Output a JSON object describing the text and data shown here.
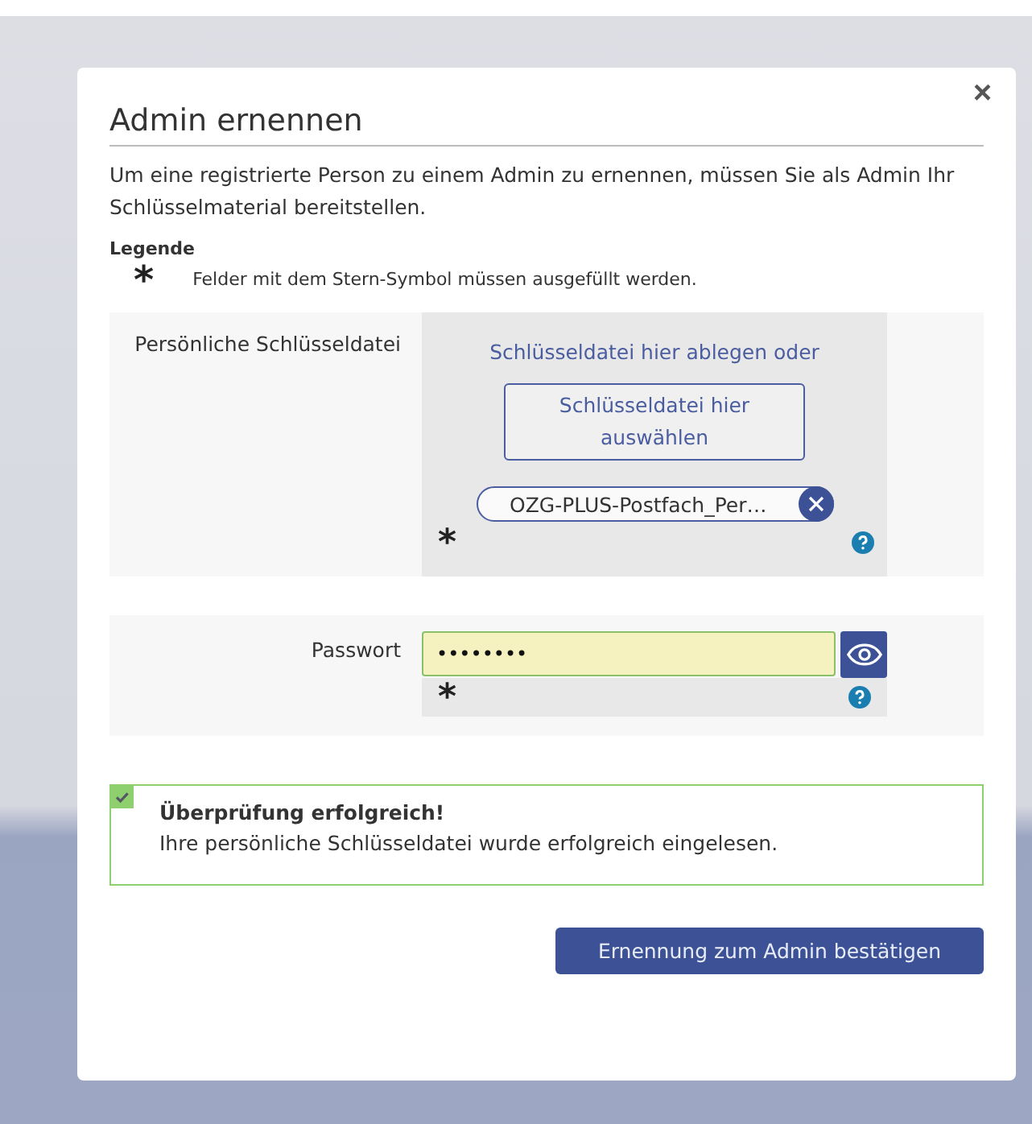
{
  "dialog": {
    "title": "Admin ernennen",
    "close": "×",
    "intro": "Um eine registrierte Person zu einem Admin zu ernennen, müssen Sie als Admin Ihr Schlüsselmaterial bereitstellen.",
    "legend": {
      "heading": "Legende",
      "symbol": "*",
      "text": "Felder mit dem Stern-Symbol müssen ausgefüllt werden."
    },
    "key_file": {
      "label": "Persönliche Schlüsseldatei",
      "drop_text": "Schlüsseldatei hier ablegen oder",
      "select_button": "Schlüsseldatei hier auswählen",
      "file_name": "OZG-PLUS-Postfach_Per…",
      "required_mark": "*"
    },
    "password": {
      "label": "Passwort",
      "value": "••••••••",
      "valid": true,
      "required_mark": "*"
    },
    "alert": {
      "kind": "success",
      "title": "Überprüfung erfolgreich!",
      "message": "Ihre persönliche Schlüsseldatei wurde erfolgreich eingelesen."
    },
    "confirm_button": "Ernennung zum Admin bestätigen"
  }
}
